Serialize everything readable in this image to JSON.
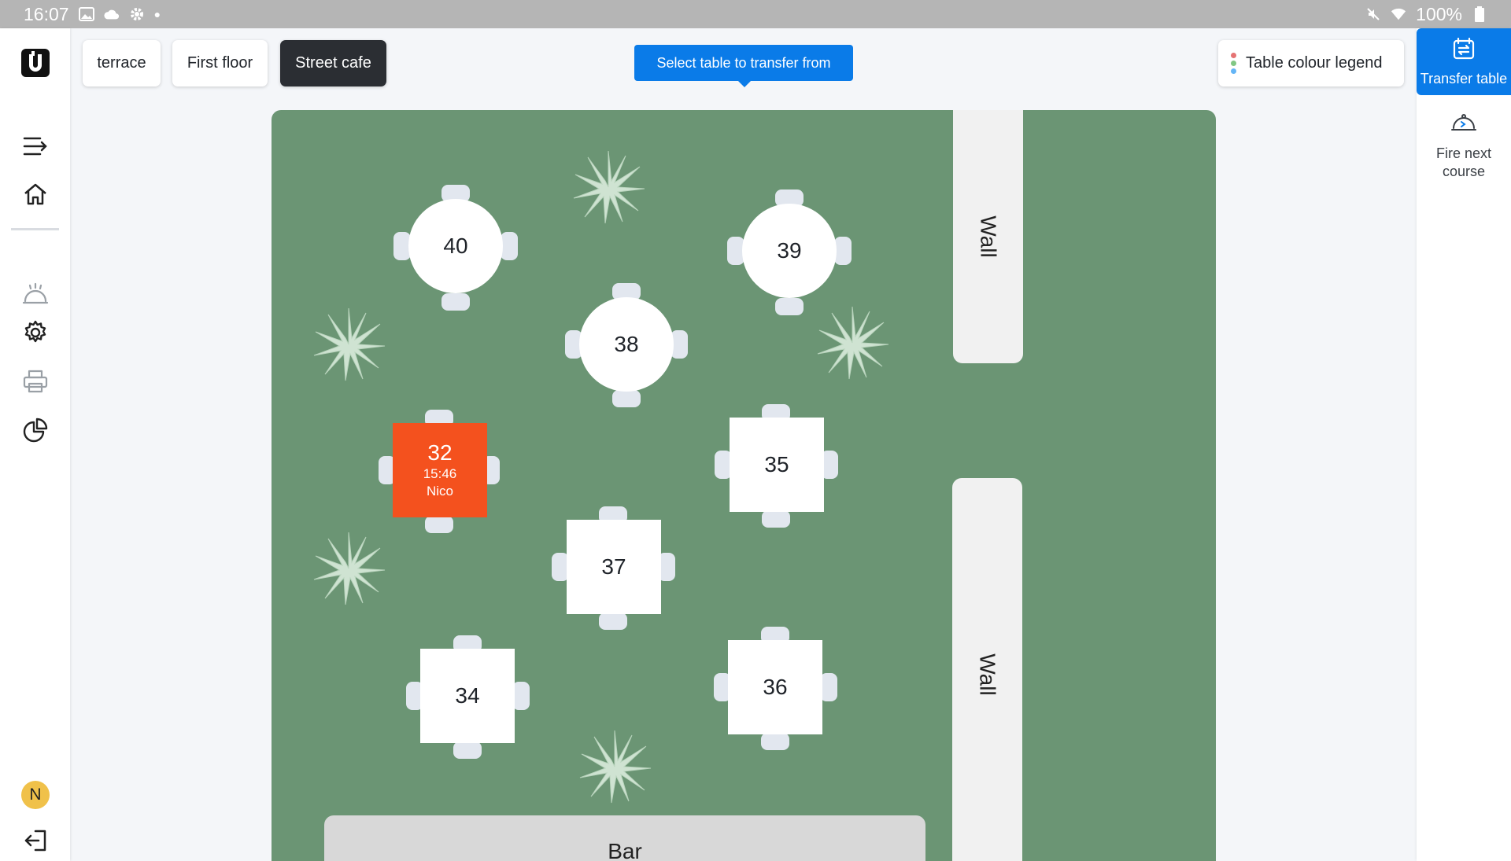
{
  "status_bar": {
    "time": "16:07",
    "battery": "100%"
  },
  "tabs": [
    {
      "label": "terrace",
      "active": false
    },
    {
      "label": "First floor",
      "active": false
    },
    {
      "label": "Street cafe",
      "active": true
    }
  ],
  "hint": {
    "text": "Select table to transfer from"
  },
  "legend_button": {
    "label": "Table colour legend",
    "dot_colors": [
      "#e57373",
      "#81c784",
      "#64b5f6"
    ]
  },
  "right_panel": {
    "transfer_label": "Transfer table",
    "fire_label": "Fire next course"
  },
  "user": {
    "initial": "N",
    "avatar_color": "#f0c14a"
  },
  "floor": {
    "background": "#6b9574",
    "walls": [
      "Wall",
      "Wall"
    ],
    "bar": "Bar",
    "tables": [
      {
        "number": "40",
        "shape": "round"
      },
      {
        "number": "39",
        "shape": "round"
      },
      {
        "number": "38",
        "shape": "round"
      },
      {
        "number": "32",
        "shape": "square",
        "status": "occupied",
        "time": "15:46",
        "waiter": "Nico",
        "color": "#f4511e"
      },
      {
        "number": "35",
        "shape": "square"
      },
      {
        "number": "37",
        "shape": "square"
      },
      {
        "number": "34",
        "shape": "square"
      },
      {
        "number": "36",
        "shape": "square"
      }
    ]
  }
}
